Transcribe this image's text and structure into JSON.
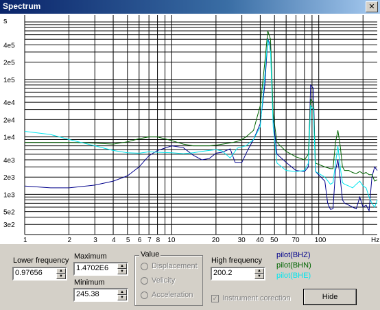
{
  "window": {
    "title": "Spectrum",
    "close_glyph": "✕"
  },
  "chart_data": {
    "type": "line",
    "ylabel": "s",
    "xlabel": "Hz",
    "xscale": "log",
    "yscale": "log",
    "xlim": [
      1,
      250
    ],
    "ylim": [
      200,
      1000000
    ],
    "grid": true,
    "x_ticks": [
      "1",
      "2",
      "3",
      "4",
      "5",
      "6",
      "7",
      "8",
      "10",
      "20",
      "30",
      "40",
      "50",
      "70",
      "100",
      "Hz"
    ],
    "y_ticks": [
      "4e5",
      "2e5",
      "1e5",
      "4e4",
      "2e4",
      "1e4",
      "4e3",
      "2e3",
      "1e3",
      "5e2",
      "3e2"
    ],
    "series": [
      {
        "name": "pilot(BHZ)",
        "color": "#00008b",
        "points": [
          [
            1,
            1400
          ],
          [
            1.5,
            1300
          ],
          [
            2,
            1300
          ],
          [
            3,
            1450
          ],
          [
            4,
            1700
          ],
          [
            5,
            2100
          ],
          [
            6,
            3000
          ],
          [
            7,
            4700
          ],
          [
            8,
            5800
          ],
          [
            10,
            7000
          ],
          [
            12,
            6500
          ],
          [
            14,
            4800
          ],
          [
            16,
            4000
          ],
          [
            18,
            4200
          ],
          [
            20,
            5200
          ],
          [
            22,
            5400
          ],
          [
            25,
            6200
          ],
          [
            27,
            3600
          ],
          [
            30,
            3600
          ],
          [
            33,
            6000
          ],
          [
            36,
            9000
          ],
          [
            40,
            17000
          ],
          [
            43,
            80000
          ],
          [
            45,
            500000
          ],
          [
            47,
            400000
          ],
          [
            49,
            22000
          ],
          [
            52,
            5000
          ],
          [
            60,
            3600
          ],
          [
            70,
            2600
          ],
          [
            80,
            2500
          ],
          [
            85,
            3000
          ],
          [
            88,
            80000
          ],
          [
            92,
            70000
          ],
          [
            95,
            2500
          ],
          [
            110,
            1700
          ],
          [
            115,
            700
          ],
          [
            120,
            550
          ],
          [
            125,
            560
          ],
          [
            130,
            2600
          ],
          [
            135,
            4000
          ],
          [
            140,
            1900
          ],
          [
            145,
            800
          ],
          [
            150,
            700
          ],
          [
            160,
            650
          ],
          [
            170,
            600
          ],
          [
            180,
            560
          ],
          [
            190,
            900
          ],
          [
            200,
            600
          ],
          [
            210,
            650
          ],
          [
            220,
            520
          ],
          [
            230,
            2000
          ],
          [
            240,
            3000
          ],
          [
            250,
            2600
          ]
        ]
      },
      {
        "name": "pilot(BHN)",
        "color": "#006400",
        "points": [
          [
            1,
            8000
          ],
          [
            1.5,
            8000
          ],
          [
            2,
            8000
          ],
          [
            3,
            7800
          ],
          [
            4,
            7500
          ],
          [
            5,
            8200
          ],
          [
            6,
            9300
          ],
          [
            7,
            10000
          ],
          [
            8,
            10000
          ],
          [
            10,
            8600
          ],
          [
            12,
            7500
          ],
          [
            14,
            7000
          ],
          [
            16,
            7000
          ],
          [
            18,
            7000
          ],
          [
            20,
            7200
          ],
          [
            23,
            7600
          ],
          [
            26,
            8000
          ],
          [
            29,
            8600
          ],
          [
            32,
            10000
          ],
          [
            36,
            13000
          ],
          [
            40,
            35000
          ],
          [
            43,
            200000
          ],
          [
            45,
            700000
          ],
          [
            47,
            500000
          ],
          [
            49,
            25000
          ],
          [
            52,
            8000
          ],
          [
            60,
            5600
          ],
          [
            70,
            4500
          ],
          [
            80,
            4000
          ],
          [
            85,
            5000
          ],
          [
            88,
            45000
          ],
          [
            92,
            40000
          ],
          [
            95,
            3500
          ],
          [
            110,
            3000
          ],
          [
            120,
            2800
          ],
          [
            125,
            2800
          ],
          [
            130,
            8000
          ],
          [
            135,
            13000
          ],
          [
            140,
            7000
          ],
          [
            145,
            3000
          ],
          [
            150,
            2600
          ],
          [
            160,
            2600
          ],
          [
            170,
            2400
          ],
          [
            180,
            2300
          ],
          [
            190,
            2500
          ],
          [
            200,
            2300
          ],
          [
            210,
            2400
          ],
          [
            220,
            2200
          ],
          [
            230,
            2200
          ],
          [
            240,
            1700
          ],
          [
            250,
            1800
          ]
        ]
      },
      {
        "name": "pilot(BHE)",
        "color": "#00e5ee",
        "points": [
          [
            1,
            12500
          ],
          [
            1.5,
            11000
          ],
          [
            2,
            9000
          ],
          [
            3,
            7000
          ],
          [
            4,
            5800
          ],
          [
            5,
            5300
          ],
          [
            6,
            5200
          ],
          [
            7,
            5500
          ],
          [
            8,
            5400
          ],
          [
            10,
            5300
          ],
          [
            12,
            5100
          ],
          [
            14,
            5300
          ],
          [
            16,
            5600
          ],
          [
            18,
            5800
          ],
          [
            20,
            6000
          ],
          [
            22,
            5700
          ],
          [
            25,
            4300
          ],
          [
            28,
            6400
          ],
          [
            32,
            7000
          ],
          [
            36,
            9000
          ],
          [
            40,
            15000
          ],
          [
            43,
            120000
          ],
          [
            45,
            500000
          ],
          [
            47,
            300000
          ],
          [
            49,
            15000
          ],
          [
            52,
            3500
          ],
          [
            60,
            2600
          ],
          [
            70,
            2500
          ],
          [
            80,
            2600
          ],
          [
            85,
            3500
          ],
          [
            88,
            35000
          ],
          [
            92,
            30000
          ],
          [
            95,
            2500
          ],
          [
            110,
            2000
          ],
          [
            120,
            1500
          ],
          [
            125,
            1600
          ],
          [
            130,
            3500
          ],
          [
            135,
            7000
          ],
          [
            140,
            3000
          ],
          [
            145,
            1600
          ],
          [
            150,
            1500
          ],
          [
            160,
            1400
          ],
          [
            170,
            1300
          ],
          [
            180,
            1500
          ],
          [
            190,
            1700
          ],
          [
            200,
            1400
          ],
          [
            210,
            1300
          ],
          [
            220,
            900
          ],
          [
            230,
            700
          ],
          [
            240,
            600
          ],
          [
            250,
            800
          ]
        ]
      }
    ]
  },
  "controls": {
    "lower_frequency_label": "Lower frequency",
    "lower_frequency_value": "0.97656",
    "maximum_label": "Maximum",
    "maximum_value": "1.4702E6",
    "minimum_label": "Minimum",
    "minimum_value": "245.38",
    "value_group_label": "Value",
    "value_options": [
      "Displacement",
      "Velicity",
      "Acceleration"
    ],
    "high_frequency_label": "High frequency",
    "high_frequency_value": "200.2",
    "instrument_correction_label": "Instrument corection",
    "instrument_correction_checked": true,
    "hide_button_label": "Hide",
    "spinner_up": "▲",
    "spinner_down": "▼",
    "check_glyph": "✓"
  },
  "legend": [
    "pilot(BHZ)",
    "pilot(BHN)",
    "pilot(BHE)"
  ]
}
